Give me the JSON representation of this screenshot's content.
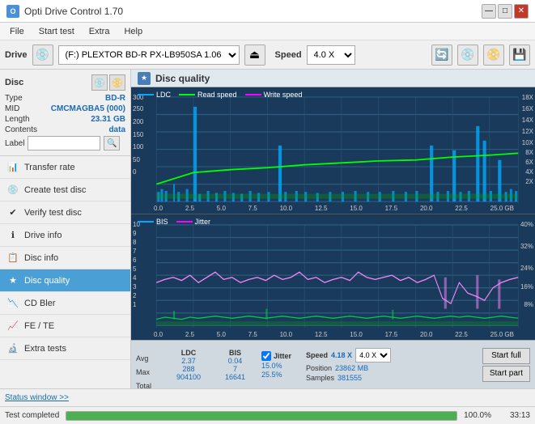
{
  "titlebar": {
    "title": "Opti Drive Control 1.70",
    "minimize_label": "—",
    "maximize_label": "□",
    "close_label": "✕"
  },
  "menu": {
    "items": [
      "File",
      "Start test",
      "Extra",
      "Help"
    ]
  },
  "drivebar": {
    "drive_label": "Drive",
    "drive_value": "(F:) PLEXTOR BD-R  PX-LB950SA 1.06",
    "speed_label": "Speed",
    "speed_value": "4.0 X"
  },
  "disc": {
    "title": "Disc",
    "type_label": "Type",
    "type_value": "BD-R",
    "mid_label": "MID",
    "mid_value": "CMCMAGBA5 (000)",
    "length_label": "Length",
    "length_value": "23.31 GB",
    "contents_label": "Contents",
    "contents_value": "data",
    "label_label": "Label",
    "label_placeholder": ""
  },
  "nav": {
    "items": [
      {
        "id": "transfer-rate",
        "label": "Transfer rate",
        "icon": "📊"
      },
      {
        "id": "create-test-disc",
        "label": "Create test disc",
        "icon": "💿"
      },
      {
        "id": "verify-test-disc",
        "label": "Verify test disc",
        "icon": "✔"
      },
      {
        "id": "drive-info",
        "label": "Drive info",
        "icon": "ℹ"
      },
      {
        "id": "disc-info",
        "label": "Disc info",
        "icon": "📋"
      },
      {
        "id": "disc-quality",
        "label": "Disc quality",
        "icon": "★",
        "active": true
      },
      {
        "id": "cd-bler",
        "label": "CD Bler",
        "icon": "📉"
      },
      {
        "id": "fe-te",
        "label": "FE / TE",
        "icon": "📈"
      },
      {
        "id": "extra-tests",
        "label": "Extra tests",
        "icon": "🔬"
      }
    ]
  },
  "quality": {
    "title": "Disc quality",
    "legend": {
      "ldc": "LDC",
      "read_speed": "Read speed",
      "write_speed": "Write speed",
      "bis": "BIS",
      "jitter": "Jitter"
    },
    "top_chart": {
      "y_left": [
        "300",
        "250",
        "200",
        "150",
        "100",
        "50",
        "0"
      ],
      "y_right": [
        "18X",
        "16X",
        "14X",
        "12X",
        "10X",
        "8X",
        "6X",
        "4X",
        "2X"
      ],
      "x_axis": [
        "0.0",
        "2.5",
        "5.0",
        "7.5",
        "10.0",
        "12.5",
        "15.0",
        "17.5",
        "20.0",
        "22.5",
        "25.0 GB"
      ]
    },
    "bottom_chart": {
      "y_left": [
        "10",
        "9",
        "8",
        "7",
        "6",
        "5",
        "4",
        "3",
        "2",
        "1"
      ],
      "y_right": [
        "40%",
        "32%",
        "24%",
        "16%",
        "8%"
      ],
      "x_axis": [
        "0.0",
        "2.5",
        "5.0",
        "7.5",
        "10.0",
        "12.5",
        "15.0",
        "17.5",
        "20.0",
        "22.5",
        "25.0 GB"
      ]
    }
  },
  "stats": {
    "ldc_label": "LDC",
    "bis_label": "BIS",
    "jitter_label": "Jitter",
    "jitter_checked": true,
    "speed_label": "Speed",
    "speed_val": "4.18 X",
    "speed_select": "4.0 X",
    "avg_label": "Avg",
    "avg_ldc": "2.37",
    "avg_bis": "0.04",
    "avg_jitter": "15.0%",
    "max_label": "Max",
    "max_ldc": "288",
    "max_bis": "7",
    "max_jitter": "25.5%",
    "total_label": "Total",
    "total_ldc": "904100",
    "total_bis": "16641",
    "position_label": "Position",
    "position_val": "23862 MB",
    "samples_label": "Samples",
    "samples_val": "381555",
    "start_full_label": "Start full",
    "start_part_label": "Start part"
  },
  "statusbar": {
    "status_text": "Test completed",
    "progress": "100.0%",
    "progress_value": 100,
    "time": "33:13"
  },
  "bottom_toolbar": {
    "status_window_label": "Status window >>"
  }
}
